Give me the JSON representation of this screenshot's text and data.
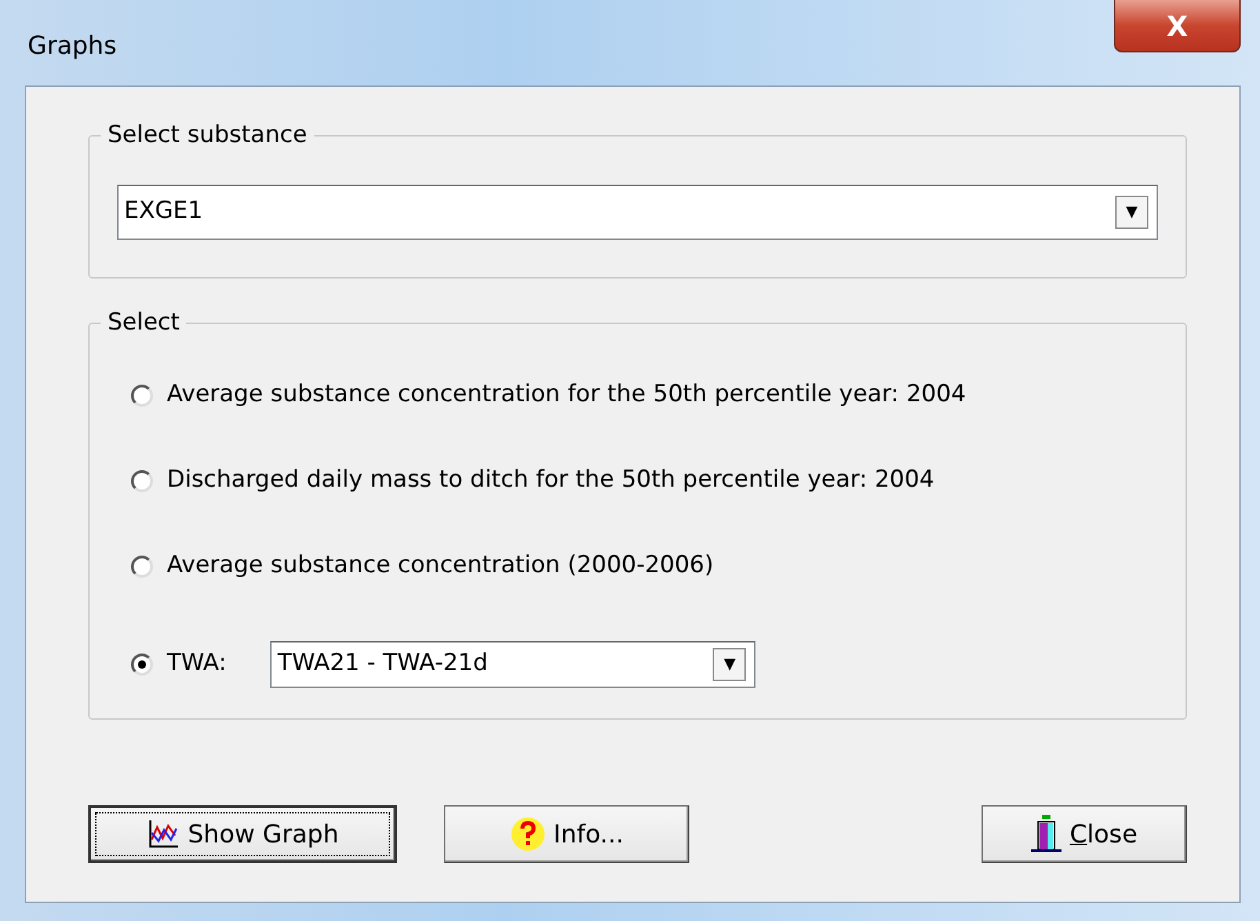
{
  "window": {
    "title": "Graphs",
    "close_glyph": "X"
  },
  "substance_group": {
    "legend": "Select substance",
    "value": "EXGE1",
    "arrow": "▼"
  },
  "select_group": {
    "legend": "Select",
    "options": [
      {
        "label": "Average substance concentration for the 50th percentile year: 2004",
        "selected": false
      },
      {
        "label": "Discharged daily mass to ditch for the 50th percentile year: 2004",
        "selected": false
      },
      {
        "label": "Average substance concentration (2000-2006)",
        "selected": false
      },
      {
        "label": "TWA:",
        "selected": true,
        "combo": {
          "value": "TWA21 - TWA-21d",
          "arrow": "▼"
        }
      }
    ]
  },
  "buttons": [
    {
      "kind": "graph",
      "label": "Show Graph",
      "focused": true
    },
    {
      "kind": "info",
      "label": "Info...",
      "focused": false
    },
    {
      "kind": "close",
      "label": "Close",
      "focused": false,
      "first_letter_underlined": true
    }
  ]
}
